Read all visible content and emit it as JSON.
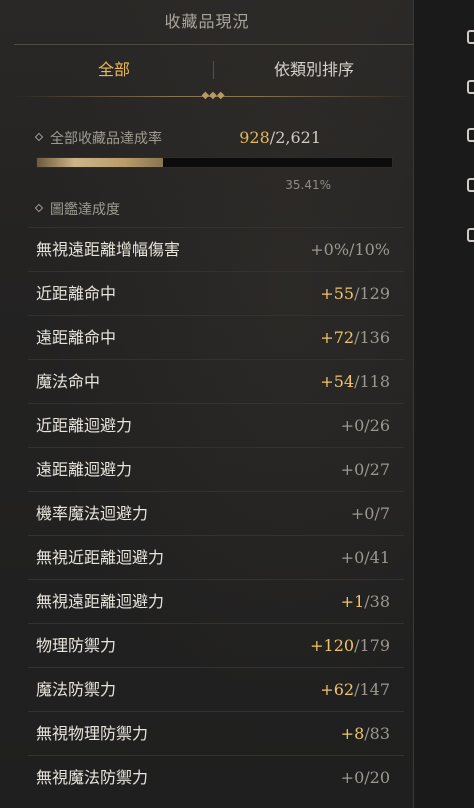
{
  "panel": {
    "title": "收藏品現況",
    "tabs": {
      "all": "全部",
      "sort": "依類別排序"
    }
  },
  "summary": {
    "label": "全部收藏品達成率",
    "current": "928",
    "separator": "/",
    "total": "2,621",
    "percent": "35.41%",
    "progress_fraction": 0.3541
  },
  "section": {
    "label": "圖鑑達成度"
  },
  "rows": [
    {
      "label": "無視遠距離增幅傷害",
      "gain": "+0%",
      "max": "10%",
      "active": false
    },
    {
      "label": "近距離命中",
      "gain": "+55",
      "max": "129",
      "active": true
    },
    {
      "label": "遠距離命中",
      "gain": "+72",
      "max": "136",
      "active": true
    },
    {
      "label": "魔法命中",
      "gain": "+54",
      "max": "118",
      "active": true
    },
    {
      "label": "近距離迴避力",
      "gain": "+0",
      "max": "26",
      "active": false
    },
    {
      "label": "遠距離迴避力",
      "gain": "+0",
      "max": "27",
      "active": false
    },
    {
      "label": "機率魔法迴避力",
      "gain": "+0",
      "max": "7",
      "active": false
    },
    {
      "label": "無視近距離迴避力",
      "gain": "+0",
      "max": "41",
      "active": false
    },
    {
      "label": "無視遠距離迴避力",
      "gain": "+1",
      "max": "38",
      "active": true
    },
    {
      "label": "物理防禦力",
      "gain": "+120",
      "max": "179",
      "active": true
    },
    {
      "label": "魔法防禦力",
      "gain": "+62",
      "max": "147",
      "active": true
    },
    {
      "label": "無視物理防禦力",
      "gain": "+8",
      "max": "83",
      "active": true
    },
    {
      "label": "無視魔法防禦力",
      "gain": "+0",
      "max": "20",
      "active": false
    }
  ],
  "colors": {
    "accent": "#e6b85a",
    "text": "#e8e4dc",
    "muted": "#9c988f"
  }
}
